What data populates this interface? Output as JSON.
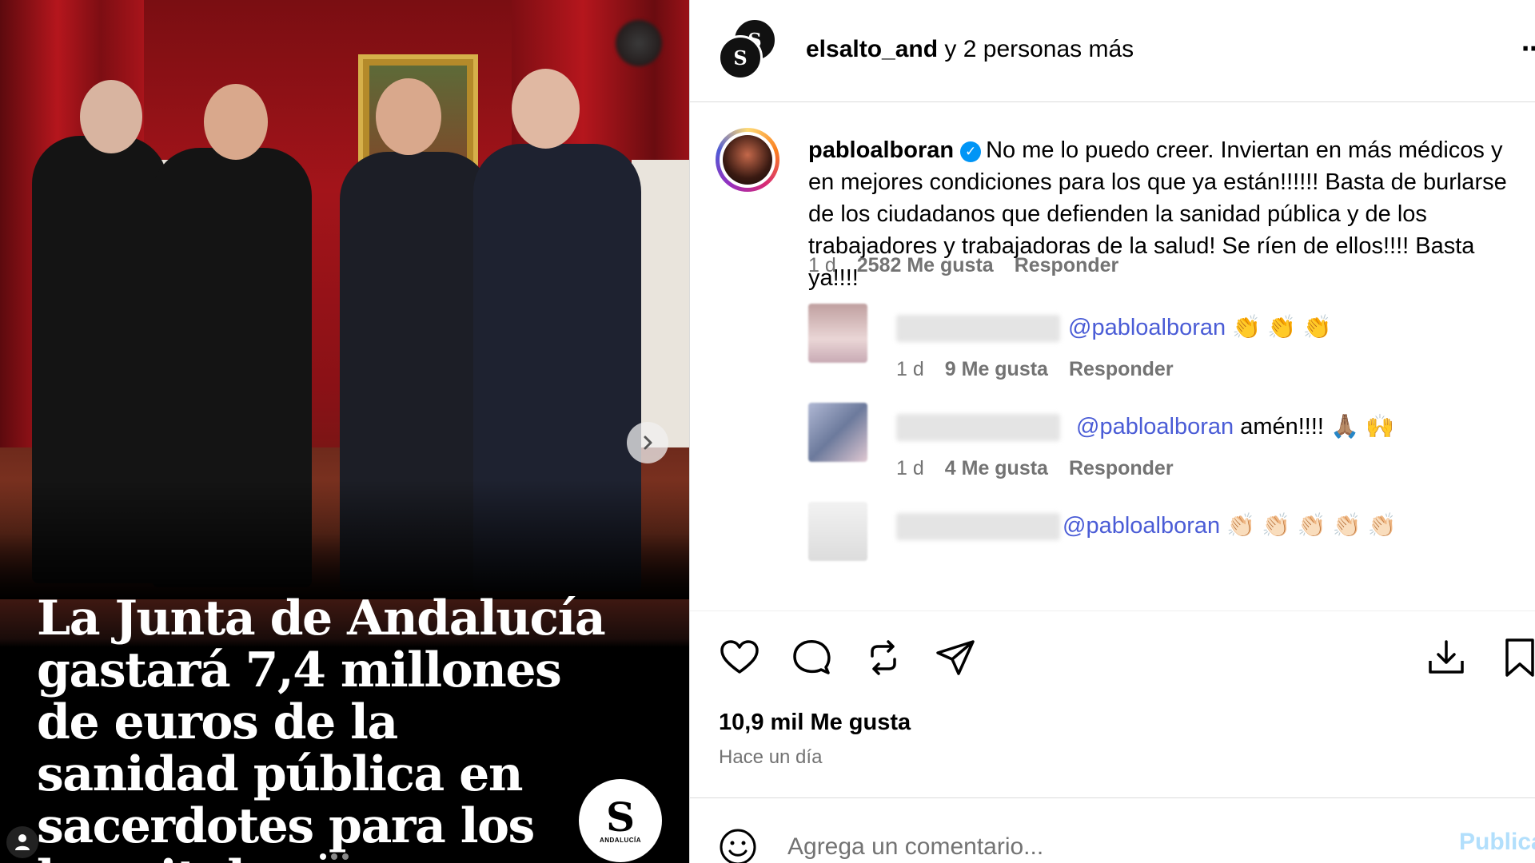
{
  "media": {
    "headline": "La Junta de Andalucía gastará 7,4 millones de euros de la sanidad pública en sacerdotes para los hospitales",
    "logo_letter": "S",
    "logo_caption": "ANDALUCÍA",
    "carousel_total": 3,
    "carousel_active": 1
  },
  "header": {
    "username": "elsalto_and",
    "collaborators": "y 2 personas más",
    "avatar_letter": "S"
  },
  "main_comment": {
    "username": "pabloalboran",
    "text": "No me lo puedo creer. Inviertan en más médicos y en mejores condiciones para los que ya están!!!!!! Basta de burlarse de los ciudadanos que defienden la sanidad pública y de los trabajadores y trabajadoras de la salud! Se ríen de ellos!!!! Basta ya!!!!",
    "time": "1 d",
    "likes": "2582 Me gusta",
    "reply_label": "Responder"
  },
  "replies": [
    {
      "mention": "@pabloalboran",
      "text": "👏 👏 👏",
      "time": "1 d",
      "likes": "9 Me gusta",
      "reply_label": "Responder"
    },
    {
      "mention": "@pabloalboran",
      "text": "amén!!!! 🙏🏽 🙌",
      "time": "1 d",
      "likes": "4 Me gusta",
      "reply_label": "Responder"
    },
    {
      "mention": "@pabloalboran",
      "text": "👏🏻 👏🏻 👏🏻 👏🏻 👏🏻",
      "time": "",
      "likes": "",
      "reply_label": ""
    }
  ],
  "actions": {
    "icons": [
      "heart-icon",
      "comment-icon",
      "repost-icon",
      "share-icon",
      "download-icon",
      "bookmark-icon"
    ]
  },
  "stats": {
    "likes": "10,9 mil Me gusta",
    "time_ago": "Hace un día"
  },
  "composer": {
    "placeholder": "Agrega un comentario...",
    "publish_label": "Publicar"
  },
  "colors": {
    "mention": "#4a5cd6",
    "verified": "#0095f6",
    "publish": "#b2dffc"
  }
}
